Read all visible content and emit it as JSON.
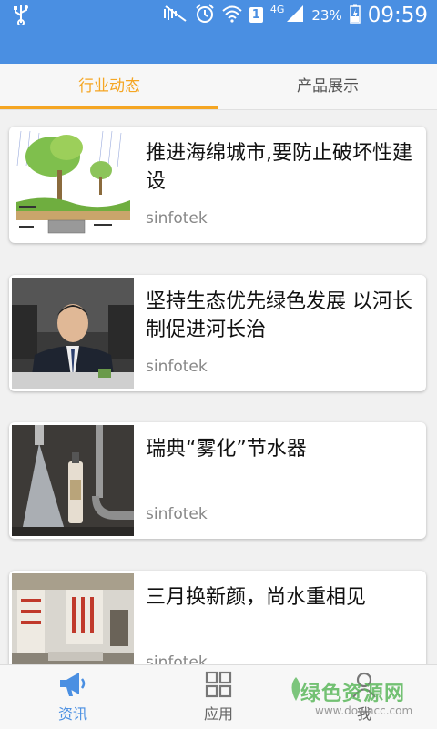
{
  "status_bar": {
    "battery": "23%",
    "time": "09:59",
    "network": "4G",
    "sim": "1"
  },
  "tabs": [
    {
      "label": "行业动态",
      "active": true
    },
    {
      "label": "产品展示",
      "active": false
    }
  ],
  "colors": {
    "primary": "#4a8fe2",
    "tab_active": "#f5a623"
  },
  "articles": [
    {
      "title": "推进海绵城市,要防止破坏性建设",
      "source": "sinfotek"
    },
    {
      "title": "坚持生态优先绿色发展 以河长制促进河长治",
      "source": "sinfotek"
    },
    {
      "title": "瑞典“雾化”节水器",
      "source": "sinfotek"
    },
    {
      "title": "三月换新颜，尚水重相见",
      "source": "sinfotek"
    }
  ],
  "bottom_nav": [
    {
      "label": "资讯",
      "icon": "megaphone-icon",
      "active": true
    },
    {
      "label": "应用",
      "icon": "grid-icon",
      "active": false
    },
    {
      "label": "我",
      "icon": "user-icon",
      "active": false
    }
  ],
  "watermark": {
    "text": "绿色资源网",
    "url": "www.downcc.com"
  }
}
